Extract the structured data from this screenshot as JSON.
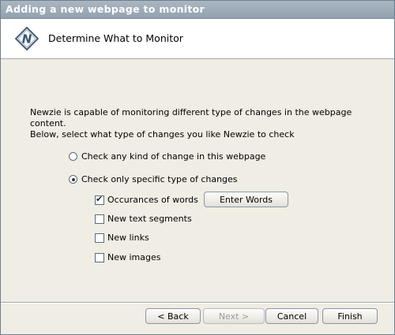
{
  "window": {
    "title": "Adding a new webpage to monitor"
  },
  "header": {
    "logo_icon": "newzie-logo-icon",
    "title": "Determine What to Monitor"
  },
  "description": {
    "line1": "Newzie is capable of monitoring different type of changes in the webpage content.",
    "line2": "Below, select what type of changes you like Newzie to check"
  },
  "options": {
    "any_change": {
      "label": "Check any kind of change in this webpage",
      "selected": false
    },
    "specific_change": {
      "label": "Check only specific type of changes",
      "selected": true
    }
  },
  "checkboxes": [
    {
      "label": "Occurances of words",
      "checked": true
    },
    {
      "label": "New text segments",
      "checked": false
    },
    {
      "label": "New links",
      "checked": false
    },
    {
      "label": "New images",
      "checked": false
    }
  ],
  "enter_words_button": "Enter Words",
  "footer": {
    "back": "< Back",
    "next": "Next >",
    "cancel": "Cancel",
    "finish": "Finish"
  }
}
